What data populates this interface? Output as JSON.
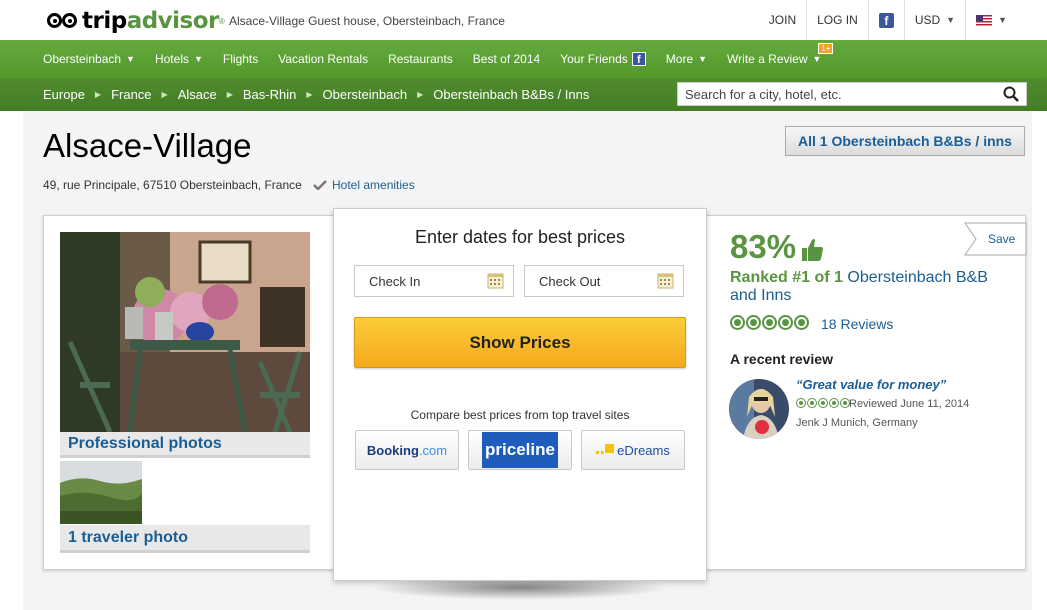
{
  "header": {
    "logo_trip": "trip",
    "logo_advisor": "advisor",
    "logo_reg": "®",
    "page_title": "Alsace-Village Guest house, Obersteinbach, France",
    "join": "JOIN",
    "login": "LOG IN",
    "currency": "USD",
    "facebook_icon": "facebook-icon",
    "flag_icon": "us-flag-icon"
  },
  "nav": {
    "items": [
      {
        "label": "Obersteinbach",
        "has_caret": true
      },
      {
        "label": "Hotels",
        "has_caret": true
      },
      {
        "label": "Flights",
        "has_caret": false
      },
      {
        "label": "Vacation Rentals",
        "has_caret": false
      },
      {
        "label": "Restaurants",
        "has_caret": false
      },
      {
        "label": "Best of 2014",
        "has_caret": false
      },
      {
        "label": "Your Friends",
        "has_caret": false
      },
      {
        "label": "More",
        "has_caret": true
      },
      {
        "label": "Write a Review",
        "has_caret": true
      }
    ],
    "badge": "1+",
    "accent": "#589442"
  },
  "breadcrumb": {
    "items": [
      "Europe",
      "France",
      "Alsace",
      "Bas-Rhin",
      "Obersteinbach",
      "Obersteinbach B&Bs / Inns"
    ],
    "separator_icon": "triangle-right-icon"
  },
  "search": {
    "placeholder": "Search for a city, hotel, etc.",
    "icon": "search-icon"
  },
  "hotel": {
    "name": "Alsace-Village",
    "address": "49, rue Principale, 67510 Obersteinbach, France",
    "amenities": "Hotel amenities",
    "all_button": "All 1 Obersteinbach B&Bs / inns"
  },
  "photos": {
    "professional": "Professional photos",
    "traveler": "1 traveler photo"
  },
  "pricing": {
    "heading": "Enter dates for best prices",
    "check_in": "Check In",
    "check_out": "Check Out",
    "show_prices": "Show Prices",
    "compare": "Compare best prices from top travel sites",
    "partners": {
      "booking_main": "Booking",
      "booking_com": ".com",
      "priceline": "priceline",
      "edreams": "eDreams"
    },
    "button_color": "#f4a91c"
  },
  "rating": {
    "save": "Save",
    "percent": "83%",
    "ranked_prefix": "Ranked #1 of 1 ",
    "ranked_link": "Obersteinbach B&B and Inns",
    "bubble_rating": 5,
    "reviews": "18 Reviews",
    "recent_heading": "A recent review",
    "review_title": "“Great value for money”",
    "review_date": "Reviewed June 11, 2014",
    "reviewer": "Jenk J Munich, Germany"
  }
}
